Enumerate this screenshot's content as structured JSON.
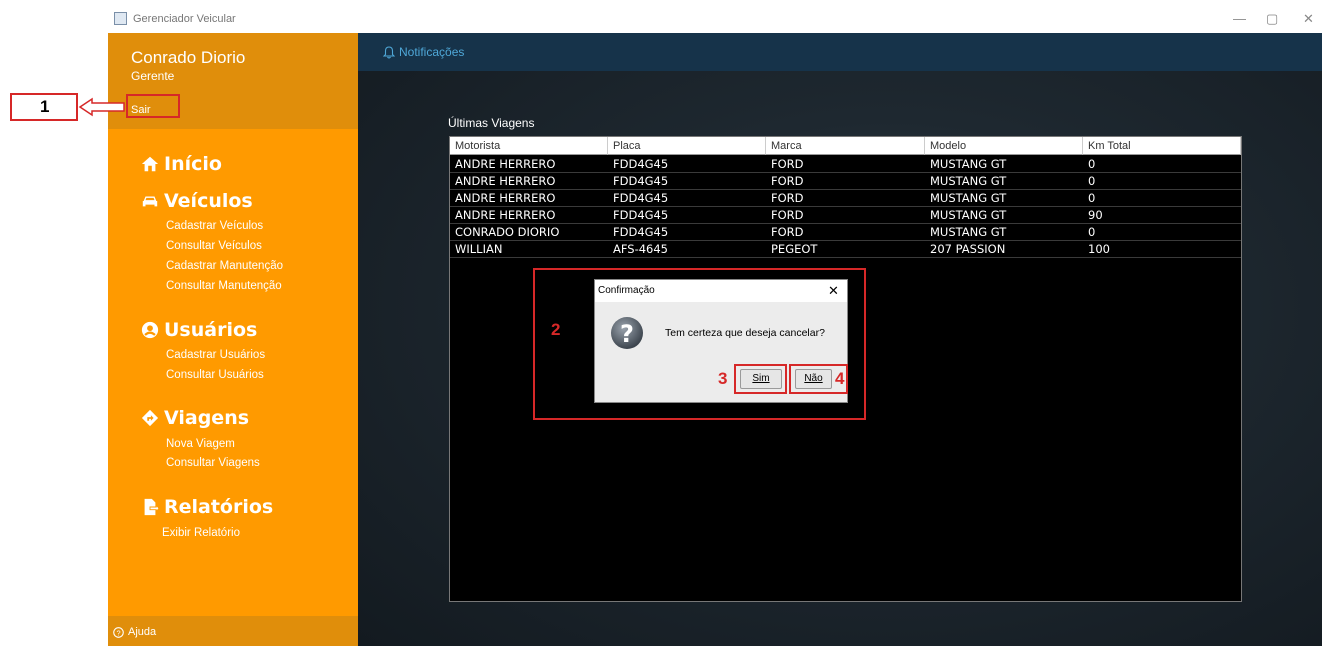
{
  "window": {
    "title": "Gerenciador Veicular",
    "controls": [
      "—",
      "▢",
      "✕"
    ]
  },
  "sidebar": {
    "user_name": "Conrado Diorio",
    "user_role": "Gerente",
    "logout_label": "Sair",
    "sections": [
      {
        "label": "Início",
        "icon": "home-icon",
        "items": []
      },
      {
        "label": "Veículos",
        "icon": "car-icon",
        "items": [
          "Cadastrar Veículos",
          "Consultar Veículos",
          "Cadastrar Manutenção",
          "Consultar Manutenção"
        ]
      },
      {
        "label": "Usuários",
        "icon": "user-circle-icon",
        "items": [
          "Cadastrar Usuários",
          "Consultar Usuários"
        ]
      },
      {
        "label": "Viagens",
        "icon": "route-sign-icon",
        "items": [
          "Nova Viagem",
          "Consultar Viagens"
        ]
      },
      {
        "label": "Relatórios",
        "icon": "report-icon",
        "items": [
          "Exibir Relatório"
        ]
      }
    ],
    "help_label": "Ajuda"
  },
  "topbar": {
    "notifications_label": "Notificações"
  },
  "trips": {
    "title": "Últimas Viagens",
    "columns": [
      "Motorista",
      "Placa",
      "Marca",
      "Modelo",
      "Km Total"
    ],
    "rows": [
      [
        "ANDRE HERRERO",
        "FDD4G45",
        "FORD",
        "MUSTANG GT",
        "0"
      ],
      [
        "ANDRE HERRERO",
        "FDD4G45",
        "FORD",
        "MUSTANG GT",
        "0"
      ],
      [
        "ANDRE HERRERO",
        "FDD4G45",
        "FORD",
        "MUSTANG GT",
        "0"
      ],
      [
        "ANDRE HERRERO",
        "FDD4G45",
        "FORD",
        "MUSTANG GT",
        "90"
      ],
      [
        "CONRADO DIORIO",
        "FDD4G45",
        "FORD",
        "MUSTANG GT",
        "0"
      ],
      [
        "WILLIAN",
        "AFS-4645",
        "PEGEOT",
        "207 PASSION",
        "100"
      ]
    ]
  },
  "dialog": {
    "title": "Confirmação",
    "message": "Tem certeza que deseja cancelar?",
    "yes_label": "Sim",
    "no_label": "Não"
  },
  "annotations": [
    "1",
    "2",
    "3",
    "4"
  ],
  "colors": {
    "sidebar": "#ff9a00",
    "sidebar_header": "#e08e0b",
    "topbar": "#16334a",
    "annotation": "#d62828"
  }
}
